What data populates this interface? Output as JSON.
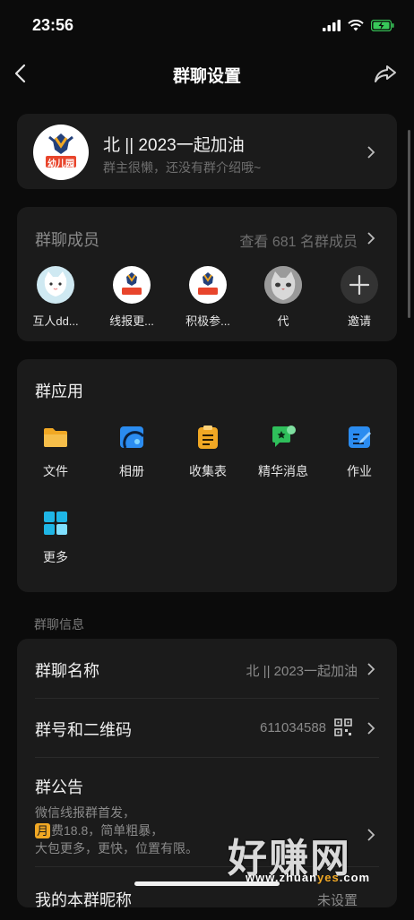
{
  "status_bar": {
    "time": "23:56"
  },
  "nav": {
    "title": "群聊设置"
  },
  "group": {
    "name": "北 || 2023一起加油",
    "description": "群主很懒，还没有群介绍哦~",
    "logo_text": "幼儿园"
  },
  "members": {
    "title": "群聊成员",
    "count_text": "查看 681 名群成员",
    "items": [
      {
        "name": "互人dd..."
      },
      {
        "name": "线报更..."
      },
      {
        "name": "积极参..."
      },
      {
        "name": "代"
      }
    ],
    "invite_label": "邀请"
  },
  "apps": {
    "title": "群应用",
    "items": [
      {
        "label": "文件",
        "icon": "folder-icon"
      },
      {
        "label": "相册",
        "icon": "album-icon"
      },
      {
        "label": "收集表",
        "icon": "clipboard-icon"
      },
      {
        "label": "精华消息",
        "icon": "highlight-message-icon"
      },
      {
        "label": "作业",
        "icon": "homework-icon"
      },
      {
        "label": "更多",
        "icon": "more-grid-icon"
      }
    ]
  },
  "info": {
    "section_label": "群聊信息",
    "name_label": "群聊名称",
    "name_value": "北 || 2023一起加油",
    "number_label": "群号和二维码",
    "number_value": "611034588",
    "notice_label": "群公告",
    "notice_line1": "微信线报群首发，",
    "notice_moon": "月",
    "notice_line2": "费18.8，简单粗暴，",
    "notice_line3": "大包更多，更快，位置有限。",
    "nickname_label": "我的本群昵称",
    "nickname_value": "未设置"
  },
  "watermark": {
    "main": "好赚网",
    "sub_a": "www.zhuan",
    "sub_b": "yes",
    "sub_c": ".com"
  },
  "colors": {
    "background": "#0b0b0b",
    "card": "#1b1b1b",
    "accent_blue": "#2b8cf0",
    "accent_yellow": "#f1a824",
    "accent_green": "#2fbf5b"
  }
}
